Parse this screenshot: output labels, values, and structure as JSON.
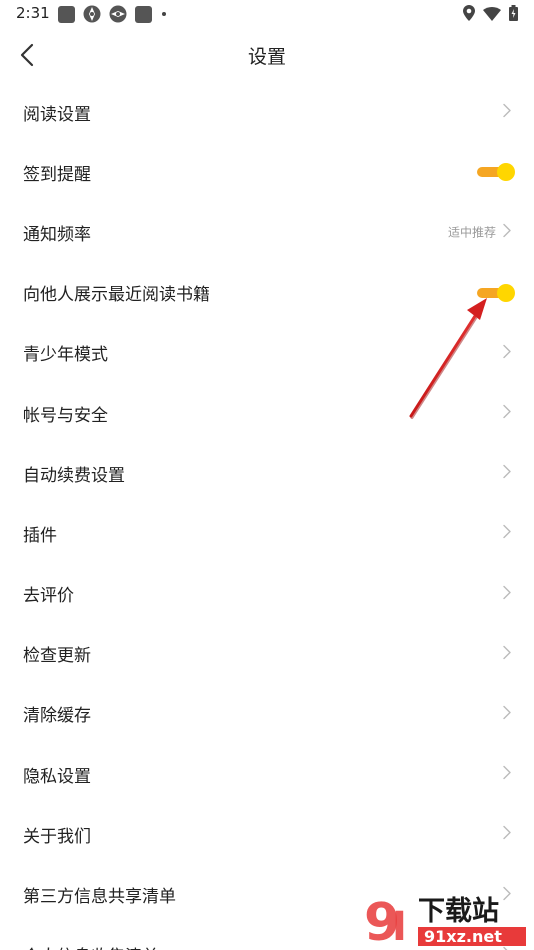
{
  "status_bar": {
    "time": "2:31",
    "left_icons": [
      "square-icon",
      "aperture-icon",
      "aperture-icon",
      "square-icon",
      "dot-icon"
    ],
    "right_icons": [
      "location-icon",
      "wifi-icon",
      "battery-icon"
    ]
  },
  "header": {
    "title": "设置",
    "back_icon": "chevron-left-icon"
  },
  "settings": [
    {
      "label": "阅读设置",
      "type": "link"
    },
    {
      "label": "签到提醒",
      "type": "toggle",
      "on": true
    },
    {
      "label": "通知频率",
      "type": "link",
      "value": "适中推荐"
    },
    {
      "label": "向他人展示最近阅读书籍",
      "type": "toggle",
      "on": true
    },
    {
      "label": "青少年模式",
      "type": "link"
    },
    {
      "label": "帐号与安全",
      "type": "link"
    },
    {
      "label": "自动续费设置",
      "type": "link"
    },
    {
      "label": "插件",
      "type": "link"
    },
    {
      "label": "去评价",
      "type": "link"
    },
    {
      "label": "检查更新",
      "type": "link"
    },
    {
      "label": "清除缓存",
      "type": "link"
    },
    {
      "label": "隐私设置",
      "type": "link"
    },
    {
      "label": "关于我们",
      "type": "link"
    },
    {
      "label": "第三方信息共享清单",
      "type": "link"
    },
    {
      "label": "个人信息收集清单",
      "type": "link"
    }
  ],
  "colors": {
    "toggle_track": "#F5A623",
    "toggle_knob": "#FFD600",
    "annotation_arrow": "#D42020",
    "watermark_red": "#E83A3A"
  },
  "watermark": {
    "brand": "下载站",
    "domain": "91xz.net"
  }
}
